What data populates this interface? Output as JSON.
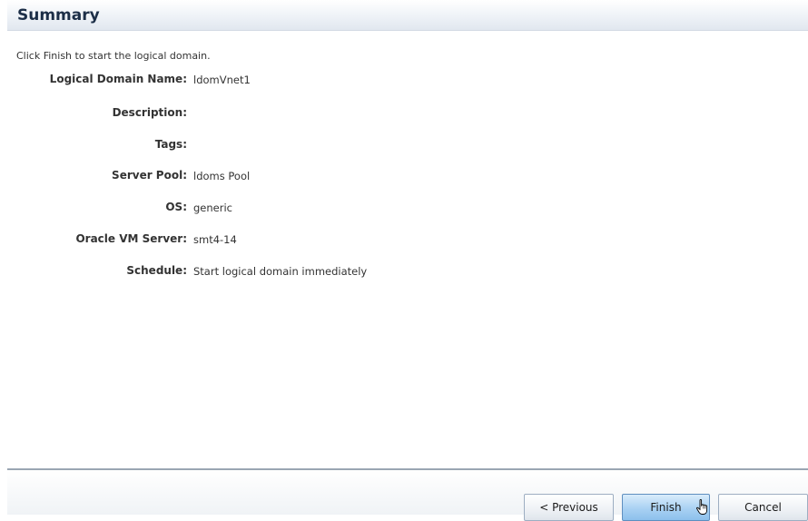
{
  "panel": {
    "title": "Summary",
    "instruction": "Click Finish to start the logical domain."
  },
  "fields": [
    {
      "label": "Logical Domain Name:",
      "value": "ldomVnet1"
    },
    {
      "label": "Description:",
      "value": ""
    },
    {
      "label": "Tags:",
      "value": ""
    },
    {
      "label": "Server Pool:",
      "value": "ldoms Pool"
    },
    {
      "label": "OS:",
      "value": "generic"
    },
    {
      "label": "Oracle VM Server:",
      "value": "smt4-14"
    },
    {
      "label": "Schedule:",
      "value": "Start logical domain immediately"
    }
  ],
  "buttons": {
    "previous": "< Previous",
    "finish": "Finish",
    "cancel": "Cancel"
  },
  "cursor": {
    "icon": "hand-pointer-icon"
  }
}
